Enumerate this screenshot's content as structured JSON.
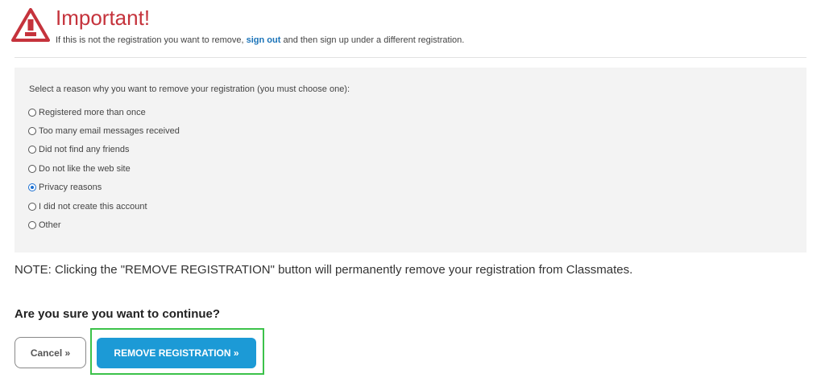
{
  "warning": {
    "title": "Important!",
    "text_before": "If this is not the registration you want to remove, ",
    "link_label": "sign out",
    "text_after": " and then sign up under a different registration.",
    "icon": "warning-triangle-icon",
    "accent_color": "#c5333c",
    "link_color": "#1a73b8"
  },
  "reasons": {
    "prompt": "Select a reason why you want to remove your registration (you must choose one):",
    "selected": "Privacy reasons",
    "options": [
      "Registered more than once",
      "Too many email messages received",
      "Did not find any friends",
      "Do not like the web site",
      "Privacy reasons",
      "I did not create this account",
      "Other"
    ]
  },
  "note": "NOTE: Clicking the \"REMOVE REGISTRATION\" button will permanently remove your registration from Classmates.",
  "confirm_question": "Are you sure you want to continue?",
  "buttons": {
    "cancel_label": "Cancel »",
    "remove_label": "REMOVE REGISTRATION »",
    "remove_color": "#1c9ad6",
    "highlight_color": "#3cc24a"
  }
}
